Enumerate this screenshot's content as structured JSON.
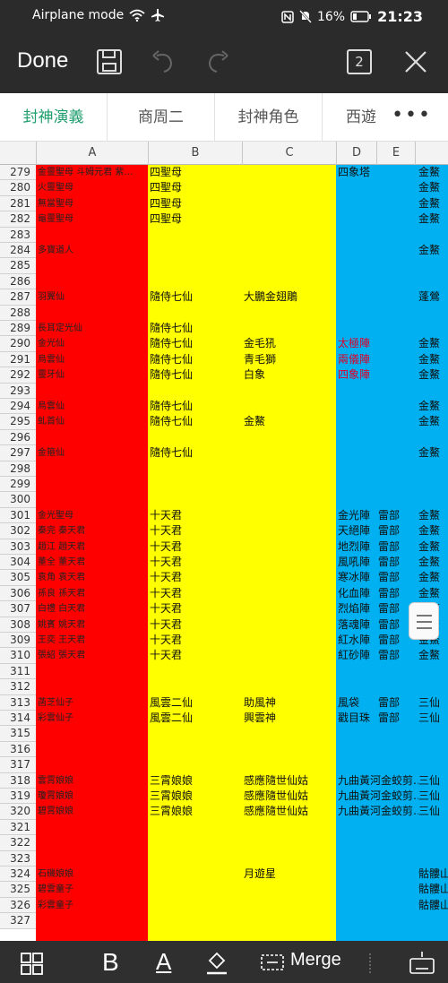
{
  "status_bar": {
    "mode": "Airplane mode",
    "battery": "16%",
    "time": "21:23"
  },
  "toolbar": {
    "done_label": "Done",
    "sheet_count": "2"
  },
  "tabs": [
    {
      "label": "封神演義",
      "active": true
    },
    {
      "label": "商周二",
      "active": false
    },
    {
      "label": "封神角色",
      "active": false
    },
    {
      "label": "西遊",
      "active": false
    }
  ],
  "columns": [
    "A",
    "B",
    "C",
    "D",
    "E",
    ""
  ],
  "colors": {
    "col_a": "#ff0000",
    "col_bc": "#ffff00",
    "col_d": "#00b0f0",
    "accent": "#1f9e6d"
  },
  "rows": [
    {
      "n": "279",
      "a": "金靈聖母 斗姆元君 紫…",
      "b": "四聖母",
      "c": "",
      "d": "四象塔",
      "e": "",
      "f": "金鰲"
    },
    {
      "n": "280",
      "a": "火靈聖母",
      "b": "四聖母",
      "c": "",
      "d": "",
      "e": "",
      "f": "金鰲"
    },
    {
      "n": "281",
      "a": "無當聖母",
      "b": "四聖母",
      "c": "",
      "d": "",
      "e": "",
      "f": "金鰲"
    },
    {
      "n": "282",
      "a": "龜靈聖母",
      "b": "四聖母",
      "c": "",
      "d": "",
      "e": "",
      "f": "金鰲"
    },
    {
      "n": "283",
      "a": "",
      "b": "",
      "c": "",
      "d": "",
      "e": "",
      "f": ""
    },
    {
      "n": "284",
      "a": "多寶道人",
      "b": "",
      "c": "",
      "d": "",
      "e": "",
      "f": "金鰲"
    },
    {
      "n": "285",
      "a": "",
      "b": "",
      "c": "",
      "d": "",
      "e": "",
      "f": ""
    },
    {
      "n": "286",
      "a": "",
      "b": "",
      "c": "",
      "d": "",
      "e": "",
      "f": ""
    },
    {
      "n": "287",
      "a": "羽翼仙",
      "b": "隨侍七仙",
      "c": "大鵬金翅鵰",
      "d": "",
      "e": "",
      "f": "蓬鶯"
    },
    {
      "n": "288",
      "a": "",
      "b": "",
      "c": "",
      "d": "",
      "e": "",
      "f": ""
    },
    {
      "n": "289",
      "a": "長耳定光仙",
      "b": "隨侍七仙",
      "c": "",
      "d": "",
      "e": "",
      "f": ""
    },
    {
      "n": "290",
      "a": "金光仙",
      "b": "隨侍七仙",
      "c": "金毛犼",
      "d": "太極陣",
      "e": "",
      "f": "金鰲",
      "d_red": true
    },
    {
      "n": "291",
      "a": "烏雲仙",
      "b": "隨侍七仙",
      "c": "青毛獅",
      "d": "兩儀陣",
      "e": "",
      "f": "金鰲",
      "d_red": true
    },
    {
      "n": "292",
      "a": "靈牙仙",
      "b": "隨侍七仙",
      "c": "白象",
      "d": "四象陣",
      "e": "",
      "f": "金鰲",
      "d_red": true
    },
    {
      "n": "293",
      "a": "",
      "b": "",
      "c": "",
      "d": "",
      "e": "",
      "f": ""
    },
    {
      "n": "294",
      "a": "烏雲仙",
      "b": "隨侍七仙",
      "c": "",
      "d": "",
      "e": "",
      "f": "金鰲"
    },
    {
      "n": "295",
      "a": "虬首仙",
      "b": "隨侍七仙",
      "c": "金鰲",
      "d": "",
      "e": "",
      "f": "金鰲"
    },
    {
      "n": "296",
      "a": "",
      "b": "",
      "c": "",
      "d": "",
      "e": "",
      "f": ""
    },
    {
      "n": "297",
      "a": "金箍仙",
      "b": "隨侍七仙",
      "c": "",
      "d": "",
      "e": "",
      "f": "金鰲"
    },
    {
      "n": "298",
      "a": "",
      "b": "",
      "c": "",
      "d": "",
      "e": "",
      "f": ""
    },
    {
      "n": "299",
      "a": "",
      "b": "",
      "c": "",
      "d": "",
      "e": "",
      "f": ""
    },
    {
      "n": "300",
      "a": "",
      "b": "",
      "c": "",
      "d": "",
      "e": "",
      "f": ""
    },
    {
      "n": "301",
      "a": "金光聖母",
      "b": "十天君",
      "c": "",
      "d": "金光陣",
      "e": "雷部",
      "f": "金鰲"
    },
    {
      "n": "302",
      "a": "秦完 秦天君",
      "b": "十天君",
      "c": "",
      "d": "天絕陣",
      "e": "雷部",
      "f": "金鰲"
    },
    {
      "n": "303",
      "a": "趙江 趙天君",
      "b": "十天君",
      "c": "",
      "d": "地烈陣",
      "e": "雷部",
      "f": "金鰲"
    },
    {
      "n": "304",
      "a": "董全 董天君",
      "b": "十天君",
      "c": "",
      "d": "風吼陣",
      "e": "雷部",
      "f": "金鰲"
    },
    {
      "n": "305",
      "a": "袁角 袁天君",
      "b": "十天君",
      "c": "",
      "d": "寒冰陣",
      "e": "雷部",
      "f": "金鰲"
    },
    {
      "n": "306",
      "a": "孫良 孫天君",
      "b": "十天君",
      "c": "",
      "d": "化血陣",
      "e": "雷部",
      "f": "金鰲"
    },
    {
      "n": "307",
      "a": "白禮 白天君",
      "b": "十天君",
      "c": "",
      "d": "烈焰陣",
      "e": "雷部",
      "f": "金鰲"
    },
    {
      "n": "308",
      "a": "姚賓 姚天君",
      "b": "十天君",
      "c": "",
      "d": "落魂陣",
      "e": "雷部",
      "f": "金鰲"
    },
    {
      "n": "309",
      "a": "王奕 王天君",
      "b": "十天君",
      "c": "",
      "d": "紅水陣",
      "e": "雷部",
      "f": "金鰲"
    },
    {
      "n": "310",
      "a": "張紹 張天君",
      "b": "十天君",
      "c": "",
      "d": "紅砂陣",
      "e": "雷部",
      "f": "金鰲"
    },
    {
      "n": "311",
      "a": "",
      "b": "",
      "c": "",
      "d": "",
      "e": "",
      "f": ""
    },
    {
      "n": "312",
      "a": "",
      "b": "",
      "c": "",
      "d": "",
      "e": "",
      "f": ""
    },
    {
      "n": "313",
      "a": "菡芝仙子",
      "b": "風雲二仙",
      "c": "助風神",
      "d": "風袋",
      "e": "雷部",
      "f": "三仙"
    },
    {
      "n": "314",
      "a": "彩雲仙子",
      "b": "風雲二仙",
      "c": "興雲神",
      "d": "戳目珠",
      "e": "雷部",
      "f": "三仙"
    },
    {
      "n": "315",
      "a": "",
      "b": "",
      "c": "",
      "d": "",
      "e": "",
      "f": ""
    },
    {
      "n": "316",
      "a": "",
      "b": "",
      "c": "",
      "d": "",
      "e": "",
      "f": ""
    },
    {
      "n": "317",
      "a": "",
      "b": "",
      "c": "",
      "d": "",
      "e": "",
      "f": ""
    },
    {
      "n": "318",
      "a": "雲霄娘娘",
      "b": "三霄娘娘",
      "c": "感應隨世仙姑",
      "d": "九曲黃河金蛟剪…",
      "e": "",
      "f": "三仙"
    },
    {
      "n": "319",
      "a": "瓊霄娘娘",
      "b": "三霄娘娘",
      "c": "感應隨世仙姑",
      "d": "九曲黃河金蛟剪…",
      "e": "",
      "f": "三仙"
    },
    {
      "n": "320",
      "a": "碧霄娘娘",
      "b": "三霄娘娘",
      "c": "感應隨世仙姑",
      "d": "九曲黃河金蛟剪…",
      "e": "",
      "f": "三仙"
    },
    {
      "n": "321",
      "a": "",
      "b": "",
      "c": "",
      "d": "",
      "e": "",
      "f": ""
    },
    {
      "n": "322",
      "a": "",
      "b": "",
      "c": "",
      "d": "",
      "e": "",
      "f": ""
    },
    {
      "n": "323",
      "a": "",
      "b": "",
      "c": "",
      "d": "",
      "e": "",
      "f": ""
    },
    {
      "n": "324",
      "a": "石磯娘娘",
      "b": "",
      "c": "月遊星",
      "d": "",
      "e": "",
      "f": "骷髏山"
    },
    {
      "n": "325",
      "a": "碧雲童子",
      "b": "",
      "c": "",
      "d": "",
      "e": "",
      "f": "骷髏山"
    },
    {
      "n": "326",
      "a": "彩雲童子",
      "b": "",
      "c": "",
      "d": "",
      "e": "",
      "f": "骷髏山"
    },
    {
      "n": "327",
      "a": "",
      "b": "",
      "c": "",
      "d": "",
      "e": "",
      "f": ""
    }
  ],
  "bottom_bar": {
    "merge_label": "Merge",
    "bold_glyph": "B",
    "color_glyph": "A"
  }
}
